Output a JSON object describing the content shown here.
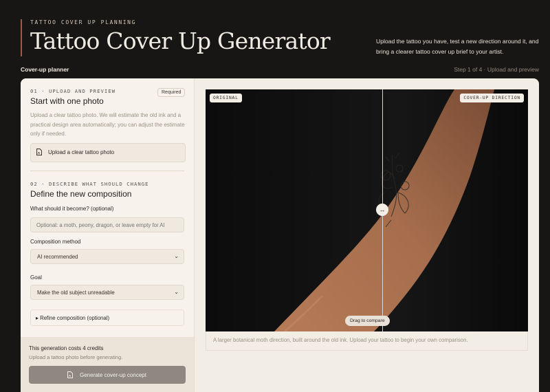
{
  "hero": {
    "eyebrow": "TATTOO COVER UP PLANNING",
    "title": "Tattoo Cover Up Generator",
    "intro": "Upload the tattoo you have, test a new direction around it, and bring a clearer tattoo cover up brief to your artist."
  },
  "planner": {
    "label": "Cover-up planner",
    "step": "Step 1 of 4 · Upload and preview"
  },
  "section1": {
    "tag": "01 · UPLOAD AND PREVIEW",
    "required": "Required",
    "title": "Start with one photo",
    "description": "Upload a clear tattoo photo. We will estimate the old ink and a practical design area automatically; you can adjust the estimate only if needed.",
    "upload_label": "Upload a clear tattoo photo",
    "upload_icon": "file-image-icon"
  },
  "section2": {
    "tag": "02 · DESCRIBE WHAT SHOULD CHANGE",
    "title": "Define the new composition",
    "become_label": "What should it become? (optional)",
    "become_placeholder": "Optional: a moth, peony, dragon, or leave empty for AI",
    "method_label": "Composition method",
    "method_value": "AI recommended",
    "goal_label": "Goal",
    "goal_value": "Make the old subject unreadable",
    "refine_label": "▸ Refine composition (optional)"
  },
  "footer": {
    "cost": "This generation costs 4 credits",
    "hint": "Upload a tattoo photo before generating.",
    "generate_label": "Generate cover-up concept"
  },
  "preview": {
    "original_tag": "ORIGINAL",
    "direction_tag": "COVER-UP DIRECTION",
    "handle_glyph": "↔",
    "drag_label": "Drag to compare",
    "caption": "A larger botanical moth direction, built around the old ink. Upload your tattoo to begin your own comparison."
  },
  "colors": {
    "background": "#181614",
    "accent": "#a45a3c",
    "panel": "#f3eee5",
    "button_disabled": "#8e8880"
  }
}
